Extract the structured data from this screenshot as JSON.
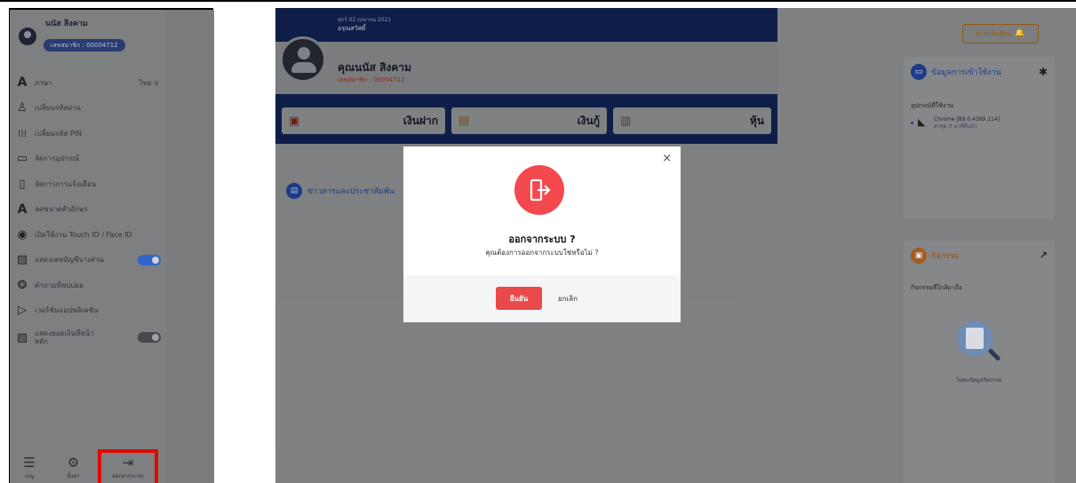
{
  "sidebar": {
    "user_name": "นนัส สิงคาม",
    "member_no": "เลขสมาชิก : 00004712",
    "items": [
      {
        "label": "ภาษา",
        "value": "ไทย ∨"
      },
      {
        "label": "เปลี่ยนรหัสผ่าน"
      },
      {
        "label": "เปลี่ยนรหัส PIN"
      },
      {
        "label": "จัดการอุปกรณ์"
      },
      {
        "label": "จัดการการแจ้งเตือน"
      },
      {
        "label": "ลดขนาดตัวอักษร"
      },
      {
        "label": "เปิดใช้งาน Touch ID / Face ID"
      },
      {
        "label": "แสดงเลขบัญชีบางส่วน",
        "toggle": "on"
      },
      {
        "label": "คำถามที่พบบ่อย"
      },
      {
        "label": "เวอร์ชั่นแอปพลิเคชัน"
      },
      {
        "label": "แสดงยอดเงินที่หน้าหลัก",
        "toggle": "off"
      }
    ],
    "bottom_nav": [
      {
        "label": "เมนู",
        "icon": "list-icon"
      },
      {
        "label": "ตั้งค่า",
        "icon": "gear-icon"
      },
      {
        "label": "ออกจากระบบ",
        "icon": "logout-icon",
        "highlighted": true
      }
    ]
  },
  "main": {
    "date": "ศุกร์ 02 เมษายน 2021",
    "greeting": "อรุณสวัสดิ์",
    "user_name": "คุณนนัส สิงคาม",
    "member_no": "เลขสมาชิก : 00004712",
    "quick_buttons": [
      {
        "label": "เงินฝาก",
        "icon": "wallet-icon"
      },
      {
        "label": "เงินกู้",
        "icon": "document-icon"
      },
      {
        "label": "หุ้น",
        "icon": "stock-chart-icon"
      }
    ],
    "news_title": "ข่าวสารและประชาสัมพัน"
  },
  "right": {
    "notify_button": "การแจ้งเตือน",
    "login_card": {
      "title": "ข้อมูลการเข้าใช้งาน",
      "subtitle": "อุปกรณ์ที่ใช้งาน",
      "device": "Chrome [89.0.4389.114]",
      "device_time": "ล่าสุด 3 นาทีที่แล้ว"
    },
    "activity_card": {
      "title": "กิจกรรม",
      "subtitle": "กิจกรรมที่ใกล้มาถึง",
      "empty_text": "ไม่พบข้อมูลกิจกรรม"
    }
  },
  "modal": {
    "title": "ออกจากระบบ ?",
    "message": "คุณต้องการออกจากระบบใช่หรือไม่ ?",
    "confirm": "ยืนยัน",
    "cancel": "ยกเลิก",
    "close": "×"
  },
  "colors": {
    "banner": "#0e1e49",
    "modal_icon_bg": "#f4484f",
    "confirm_bg": "#e8494a",
    "highlight_border": "#e10600",
    "toggle_on": "#2f66c8"
  }
}
